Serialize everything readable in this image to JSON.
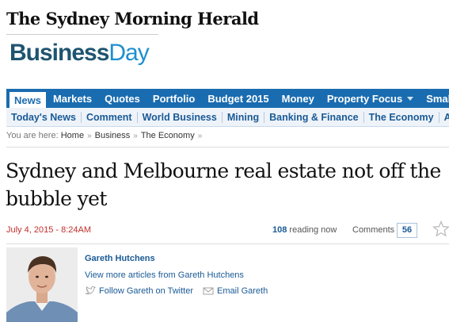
{
  "masthead": {
    "publication": "The Sydney Morning Herald",
    "section_part1": "Business",
    "section_part2": "Day"
  },
  "nav_primary": [
    {
      "label": "News",
      "active": true
    },
    {
      "label": "Markets"
    },
    {
      "label": "Quotes"
    },
    {
      "label": "Portfolio"
    },
    {
      "label": "Budget 2015"
    },
    {
      "label": "Money"
    },
    {
      "label": "Property Focus"
    },
    {
      "label": "Small Busi"
    }
  ],
  "nav_secondary": [
    "Today's News",
    "Comment",
    "World Business",
    "Mining",
    "Banking & Finance",
    "The Economy",
    "Av"
  ],
  "breadcrumb": {
    "prefix": "You are here:",
    "items": [
      "Home",
      "Business",
      "The Economy"
    ],
    "separator": "»"
  },
  "article": {
    "headline": "Sydney and Melbourne real estate not off the bubble yet",
    "date": "July 4, 2015 - 8:24AM",
    "reading_count": "108",
    "reading_label": "reading now",
    "comments_label": "Comments",
    "comments_count": "56"
  },
  "author": {
    "name": "Gareth Hutchens",
    "more_articles": "View more articles from Gareth Hutchens",
    "twitter": "Follow Gareth on Twitter",
    "email": "Email Gareth"
  },
  "colors": {
    "nav_blue": "#1a6cb0",
    "link_blue": "#1a5a96",
    "date_red": "#c0302b"
  }
}
